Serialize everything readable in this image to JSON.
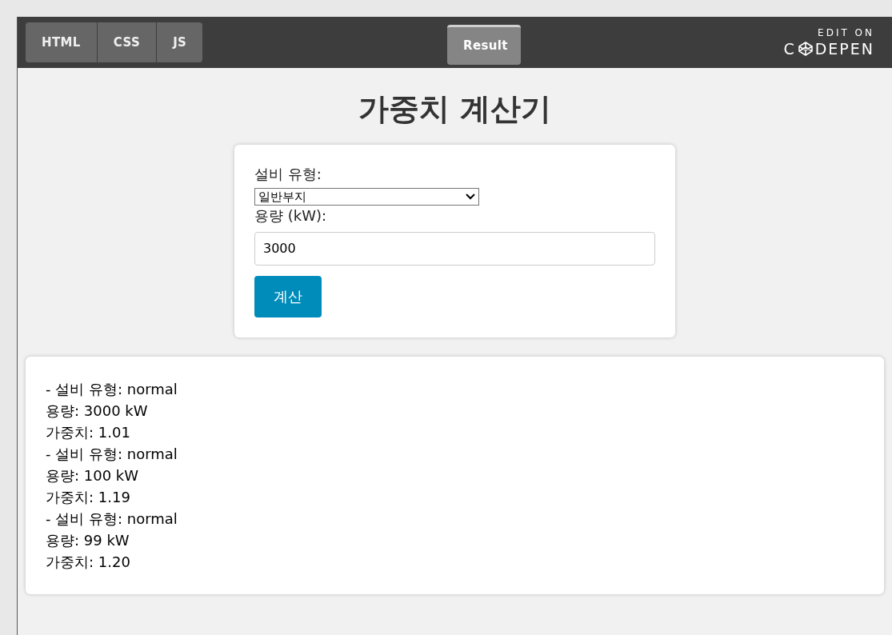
{
  "code_tabs": [
    {
      "label": "HTML",
      "selected": false
    },
    {
      "label": "CSS",
      "selected": false
    },
    {
      "label": "JS",
      "selected": false
    }
  ],
  "result_tabs": [
    {
      "label": "Result",
      "selected": true
    }
  ],
  "edit_on": "EDIT ON",
  "logo": {
    "text_start": "C",
    "text_end": "DEPEN"
  },
  "title": "가중치 계산기",
  "form": {
    "type_label": "설비 유형:",
    "type_value": "일반부지",
    "capacity_label": "용량 (kW):",
    "capacity_value": "3000",
    "button": "계산"
  },
  "results": [
    {
      "lines": [
        "- 설비 유형: normal",
        "용량: 3000 kW",
        "가중치: 1.01"
      ]
    },
    {
      "lines": [
        "- 설비 유형: normal",
        "용량: 100 kW",
        "가중치: 1.19"
      ]
    },
    {
      "lines": [
        "- 설비 유형: normal",
        "용량: 99 kW",
        "가중치: 1.20"
      ]
    }
  ]
}
